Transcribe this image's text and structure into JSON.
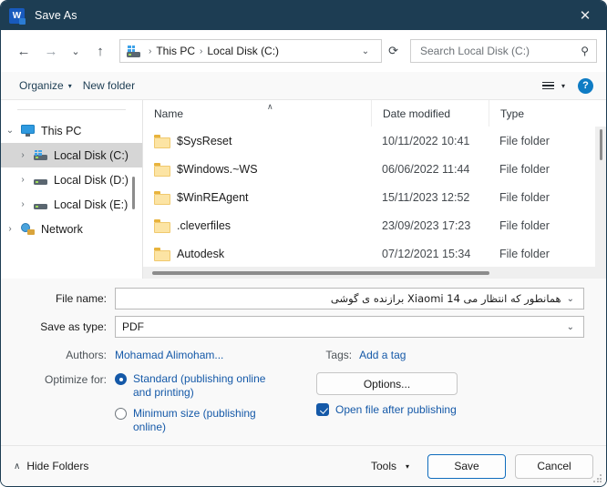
{
  "window": {
    "title": "Save As",
    "app_icon": "word-icon",
    "close_label": "✕",
    "titlebar_color": "#1d3d53"
  },
  "nav": {
    "back": "←",
    "forward": "→",
    "recent": "⌄",
    "up": "↑"
  },
  "address": {
    "drive_icon": "windows-drive-icon",
    "crumbs": [
      "This PC",
      "Local Disk (C:)"
    ],
    "separator": "›",
    "dropdown": "⌄",
    "refresh": "⟳"
  },
  "search": {
    "placeholder": "Search Local Disk (C:)",
    "value": "",
    "icon": "search-icon"
  },
  "toolbar": {
    "organize_label": "Organize",
    "organize_caret": "▾",
    "new_folder_label": "New folder",
    "view_caret": "▾",
    "help_label": "?"
  },
  "sidebar": {
    "items": [
      {
        "label": "This PC",
        "icon": "monitor-icon",
        "twisty": "⌄",
        "indent": 0,
        "selected": false,
        "expanded": true
      },
      {
        "label": "Local Disk (C:)",
        "icon": "drive-icon",
        "twisty": "›",
        "indent": 1,
        "selected": true,
        "expanded": false
      },
      {
        "label": "Local Disk (D:)",
        "icon": "drive-icon",
        "twisty": "›",
        "indent": 1,
        "selected": false,
        "expanded": false
      },
      {
        "label": "Local Disk (E:)",
        "icon": "drive-icon",
        "twisty": "›",
        "indent": 1,
        "selected": false,
        "expanded": false
      },
      {
        "label": "Network",
        "icon": "network-icon",
        "twisty": "›",
        "indent": 0,
        "selected": false,
        "expanded": false
      }
    ]
  },
  "filelist": {
    "columns": [
      "Name",
      "Date modified",
      "Type"
    ],
    "sort_indicator": "∧",
    "rows": [
      {
        "name": "$SysReset",
        "date": "10/11/2022 10:41",
        "type": "File folder"
      },
      {
        "name": "$Windows.~WS",
        "date": "06/06/2022 11:44",
        "type": "File folder"
      },
      {
        "name": "$WinREAgent",
        "date": "15/11/2023 12:52",
        "type": "File folder"
      },
      {
        "name": ".cleverfiles",
        "date": "23/09/2023 17:23",
        "type": "File folder"
      },
      {
        "name": "Autodesk",
        "date": "07/12/2021 15:34",
        "type": "File folder"
      }
    ]
  },
  "form": {
    "filename_label": "File name:",
    "filename_value": "همانطور که انتظار می Xiaomi 14 برازنده ی گوشی",
    "savetype_label": "Save as type:",
    "savetype_value": "PDF",
    "dropdown_glyph": "⌄",
    "authors_label": "Authors:",
    "authors_value": "Mohamad Alimoham...",
    "tags_label": "Tags:",
    "tags_value": "Add a tag",
    "optimize_label": "Optimize for:",
    "radio_standard": "Standard (publishing online and printing)",
    "radio_minimum": "Minimum size (publishing online)",
    "selected_option": "standard",
    "options_button": "Options...",
    "open_after_label": "Open file after publishing",
    "open_after_checked": true
  },
  "footer": {
    "hide_folders_caret": "∧",
    "hide_folders_label": "Hide Folders",
    "tools_label": "Tools",
    "tools_caret": "▾",
    "save_label": "Save",
    "cancel_label": "Cancel"
  },
  "colors": {
    "accent": "#1559a8",
    "title_bar": "#1d3d53",
    "primary_button_border": "#0f6cbd",
    "folder_icon": "#fce4a4"
  }
}
